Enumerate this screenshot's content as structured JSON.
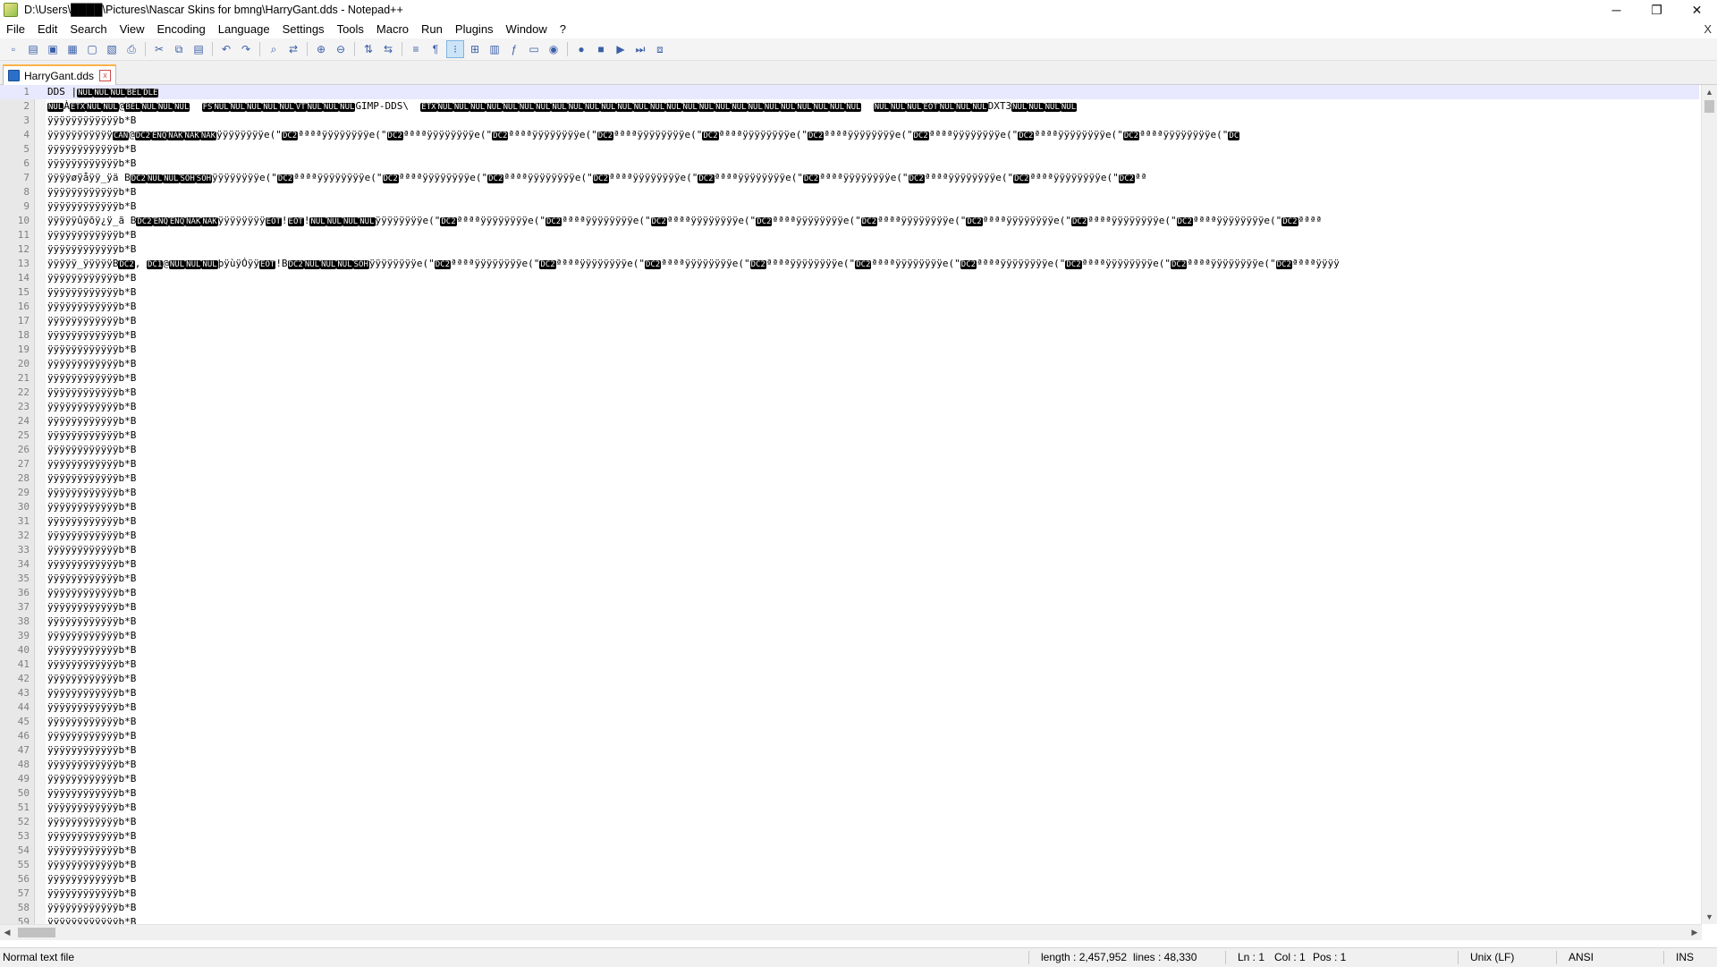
{
  "window": {
    "title": "D:\\Users\\████\\Pictures\\Nascar Skins for bmng\\HarryGant.dds - Notepad++",
    "minimize": "─",
    "restore": "❐",
    "close": "✕"
  },
  "menu": {
    "items": [
      "File",
      "Edit",
      "Search",
      "View",
      "Encoding",
      "Language",
      "Settings",
      "Tools",
      "Macro",
      "Run",
      "Plugins",
      "Window",
      "?"
    ],
    "close_doc": "X"
  },
  "toolbar": {
    "icons": [
      "new-file-icon",
      "open-file-icon",
      "save-icon",
      "save-all-icon",
      "close-icon",
      "close-all-icon",
      "print-icon",
      "|",
      "cut-icon",
      "copy-icon",
      "paste-icon",
      "|",
      "undo-icon",
      "redo-icon",
      "|",
      "find-icon",
      "replace-icon",
      "|",
      "zoom-in-icon",
      "zoom-out-icon",
      "|",
      "sync-vertical-icon",
      "sync-horizontal-icon",
      "|",
      "word-wrap-icon",
      "show-all-chars-icon",
      "indent-guide-icon",
      "user-language-icon",
      "document-map-icon",
      "function-list-icon",
      "folder-as-workspace-icon",
      "monitoring-icon",
      "|",
      "record-macro-icon",
      "stop-macro-icon",
      "play-macro-icon",
      "run-macro-multiple-icon",
      "save-macro-icon"
    ],
    "glyphs": [
      "▫",
      "▤",
      "▣",
      "▦",
      "▢",
      "▧",
      "⎙",
      "|",
      "✂",
      "⧉",
      "▤",
      "|",
      "↶",
      "↷",
      "|",
      "⌕",
      "⇄",
      "|",
      "⊕",
      "⊖",
      "|",
      "⇅",
      "⇆",
      "|",
      "≡",
      "¶",
      "⁝",
      "⊞",
      "▥",
      "ƒ",
      "▭",
      "◉",
      "|",
      "●",
      "■",
      "▶",
      "⏭",
      "⧈"
    ]
  },
  "tab": {
    "label": "HarryGant.dds",
    "close": "x"
  },
  "editor": {
    "lines": [
      {
        "n": "1",
        "parts": [
          {
            "t": "DDS |"
          },
          {
            "c": "NUL"
          },
          {
            "c": "NUL"
          },
          {
            "c": "NUL"
          },
          {
            "c": "BEL"
          },
          {
            "c": "DLE"
          }
        ]
      },
      {
        "n": "2",
        "parts": [
          {
            "c": "NUL"
          },
          {
            "t": "À"
          },
          {
            "c": "ETX"
          },
          {
            "c": "NUL"
          },
          {
            "c": "NUL"
          },
          {
            "t": "@"
          },
          {
            "c": "BEL"
          },
          {
            "c": "NUL"
          },
          {
            "c": "NUL"
          },
          {
            "c": "NUL"
          },
          {
            "t": "  "
          },
          {
            "c": "FS"
          },
          {
            "c": "NUL"
          },
          {
            "c": "NUL"
          },
          {
            "c": "NUL"
          },
          {
            "c": "NUL"
          },
          {
            "c": "NUL"
          },
          {
            "c": "VT"
          },
          {
            "c": "NUL"
          },
          {
            "c": "NUL"
          },
          {
            "c": "NUL"
          },
          {
            "t": "GIMP-DDS\\  "
          },
          {
            "c": "ETX"
          },
          {
            "c": "NUL"
          },
          {
            "c": "NUL"
          },
          {
            "c": "NUL"
          },
          {
            "c": "NUL"
          },
          {
            "c": "NUL"
          },
          {
            "c": "NUL"
          },
          {
            "c": "NUL"
          },
          {
            "c": "NUL"
          },
          {
            "c": "NUL"
          },
          {
            "c": "NUL"
          },
          {
            "c": "NUL"
          },
          {
            "c": "NUL"
          },
          {
            "c": "NUL"
          },
          {
            "c": "NUL"
          },
          {
            "c": "NUL"
          },
          {
            "c": "NUL"
          },
          {
            "c": "NUL"
          },
          {
            "c": "NUL"
          },
          {
            "c": "NUL"
          },
          {
            "c": "NUL"
          },
          {
            "c": "NUL"
          },
          {
            "c": "NUL"
          },
          {
            "c": "NUL"
          },
          {
            "c": "NUL"
          },
          {
            "c": "NUL"
          },
          {
            "c": "NUL"
          },
          {
            "t": "  "
          },
          {
            "c": "NUL"
          },
          {
            "c": "NUL"
          },
          {
            "c": "NUL"
          },
          {
            "c": "EOT"
          },
          {
            "c": "NUL"
          },
          {
            "c": "NUL"
          },
          {
            "c": "NUL"
          },
          {
            "t": "DXT3"
          },
          {
            "c": "NUL"
          },
          {
            "c": "NUL"
          },
          {
            "c": "NUL"
          },
          {
            "c": "NUL"
          }
        ]
      },
      {
        "n": "3",
        "parts": [
          {
            "t": "ÿÿÿÿÿÿÿÿÿÿÿÿb*B"
          }
        ]
      },
      {
        "n": "4",
        "parts": [
          {
            "t": "ÿÿÿÿÿÿÿÿÿÿÿ"
          },
          {
            "c": "CAN"
          },
          {
            "t": "@"
          },
          {
            "c": "DC2"
          },
          {
            "c": "ENQ"
          },
          {
            "c": "NAK"
          },
          {
            "c": "NAK"
          },
          {
            "c": "NAK"
          },
          {
            "t": "ÿÿÿÿÿÿÿÿe(\""
          },
          {
            "c": "DC2"
          },
          {
            "t": "ªªªªÿÿÿÿÿÿÿÿe(\""
          },
          {
            "c": "DC2"
          },
          {
            "t": "ªªªªÿÿÿÿÿÿÿÿe(\""
          },
          {
            "c": "DC2"
          },
          {
            "t": "ªªªªÿÿÿÿÿÿÿÿe(\""
          },
          {
            "c": "DC2"
          },
          {
            "t": "ªªªªÿÿÿÿÿÿÿÿe(\""
          },
          {
            "c": "DC2"
          },
          {
            "t": "ªªªªÿÿÿÿÿÿÿÿe(\""
          },
          {
            "c": "DC2"
          },
          {
            "t": "ªªªªÿÿÿÿÿÿÿÿe(\""
          },
          {
            "c": "DC2"
          },
          {
            "t": "ªªªªÿÿÿÿÿÿÿÿe(\""
          },
          {
            "c": "DC2"
          },
          {
            "t": "ªªªªÿÿÿÿÿÿÿÿe(\""
          },
          {
            "c": "DC2"
          },
          {
            "t": "ªªªªÿÿÿÿÿÿÿÿe(\""
          },
          {
            "c": "DC"
          }
        ]
      },
      {
        "n": "5",
        "parts": [
          {
            "t": "ÿÿÿÿÿÿÿÿÿÿÿÿb*B"
          }
        ]
      },
      {
        "n": "6",
        "parts": [
          {
            "t": "ÿÿÿÿÿÿÿÿÿÿÿÿb*B"
          }
        ]
      },
      {
        "n": "7",
        "parts": [
          {
            "t": "ÿÿÿÿøÿåÿÿ_ÿä B"
          },
          {
            "c": "DC2"
          },
          {
            "c": "NUL"
          },
          {
            "c": "NUL"
          },
          {
            "c": "SOH"
          },
          {
            "c": "SOH"
          },
          {
            "t": "ÿÿÿÿÿÿÿÿe(\""
          },
          {
            "c": "DC2"
          },
          {
            "t": "ªªªªÿÿÿÿÿÿÿÿe(\""
          },
          {
            "c": "DC2"
          },
          {
            "t": "ªªªªÿÿÿÿÿÿÿÿe(\""
          },
          {
            "c": "DC2"
          },
          {
            "t": "ªªªªÿÿÿÿÿÿÿÿe(\""
          },
          {
            "c": "DC2"
          },
          {
            "t": "ªªªªÿÿÿÿÿÿÿÿe(\""
          },
          {
            "c": "DC2"
          },
          {
            "t": "ªªªªÿÿÿÿÿÿÿÿe(\""
          },
          {
            "c": "DC2"
          },
          {
            "t": "ªªªªÿÿÿÿÿÿÿÿe(\""
          },
          {
            "c": "DC2"
          },
          {
            "t": "ªªªªÿÿÿÿÿÿÿÿe(\""
          },
          {
            "c": "DC2"
          },
          {
            "t": "ªªªªÿÿÿÿÿÿÿÿe(\""
          },
          {
            "c": "DC2"
          },
          {
            "t": "ªª"
          }
        ]
      },
      {
        "n": "8",
        "parts": [
          {
            "t": "ÿÿÿÿÿÿÿÿÿÿÿÿb*B"
          }
        ]
      },
      {
        "n": "9",
        "parts": [
          {
            "t": "ÿÿÿÿÿÿÿÿÿÿÿÿb*B"
          }
        ]
      },
      {
        "n": "10",
        "parts": [
          {
            "t": "ÿÿÿÿÿûÿõÿ¿ÿ_ã B"
          },
          {
            "c": "DC2"
          },
          {
            "c": "ENQ"
          },
          {
            "c": "ENQ"
          },
          {
            "c": "NAK"
          },
          {
            "c": "NAK"
          },
          {
            "t": "ÿÿÿÿÿÿÿÿ"
          },
          {
            "c": "EOT"
          },
          {
            "t": "!"
          },
          {
            "c": "EOT"
          },
          {
            "t": "!"
          },
          {
            "c": "NUL"
          },
          {
            "c": "NUL"
          },
          {
            "c": "NUL"
          },
          {
            "c": "NUL"
          },
          {
            "t": "ÿÿÿÿÿÿÿÿe(\""
          },
          {
            "c": "DC2"
          },
          {
            "t": "ªªªªÿÿÿÿÿÿÿÿe(\""
          },
          {
            "c": "DC2"
          },
          {
            "t": "ªªªªÿÿÿÿÿÿÿÿe(\""
          },
          {
            "c": "DC2"
          },
          {
            "t": "ªªªªÿÿÿÿÿÿÿÿe(\""
          },
          {
            "c": "DC2"
          },
          {
            "t": "ªªªªÿÿÿÿÿÿÿÿe(\""
          },
          {
            "c": "DC2"
          },
          {
            "t": "ªªªªÿÿÿÿÿÿÿÿe(\""
          },
          {
            "c": "DC2"
          },
          {
            "t": "ªªªªÿÿÿÿÿÿÿÿe(\""
          },
          {
            "c": "DC2"
          },
          {
            "t": "ªªªªÿÿÿÿÿÿÿÿe(\""
          },
          {
            "c": "DC2"
          },
          {
            "t": "ªªªªÿÿÿÿÿÿÿÿe(\""
          },
          {
            "c": "DC2"
          },
          {
            "t": "ªªªª"
          }
        ]
      },
      {
        "n": "11",
        "parts": [
          {
            "t": "ÿÿÿÿÿÿÿÿÿÿÿÿb*B"
          }
        ]
      },
      {
        "n": "12",
        "parts": [
          {
            "t": "ÿÿÿÿÿÿÿÿÿÿÿÿb*B"
          }
        ]
      },
      {
        "n": "13",
        "parts": [
          {
            "t": "ÿÿÿÿÿ_ÿÿÿÿÿB"
          },
          {
            "c": "DC2"
          },
          {
            "t": ", "
          },
          {
            "c": "DC1"
          },
          {
            "t": "@"
          },
          {
            "c": "NUL"
          },
          {
            "c": "NUL"
          },
          {
            "c": "NUL"
          },
          {
            "t": "þÿùÿÓÿÿ"
          },
          {
            "c": "EOT"
          },
          {
            "t": "!B"
          },
          {
            "c": "DC2"
          },
          {
            "c": "NUL"
          },
          {
            "c": "NUL"
          },
          {
            "c": "NUL"
          },
          {
            "c": "SOH"
          },
          {
            "t": "ÿÿÿÿÿÿÿÿe(\""
          },
          {
            "c": "DC2"
          },
          {
            "t": "ªªªªÿÿÿÿÿÿÿÿe(\""
          },
          {
            "c": "DC2"
          },
          {
            "t": "ªªªªÿÿÿÿÿÿÿÿe(\""
          },
          {
            "c": "DC2"
          },
          {
            "t": "ªªªªÿÿÿÿÿÿÿÿe(\""
          },
          {
            "c": "DC2"
          },
          {
            "t": "ªªªªÿÿÿÿÿÿÿÿe(\""
          },
          {
            "c": "DC2"
          },
          {
            "t": "ªªªªÿÿÿÿÿÿÿÿe(\""
          },
          {
            "c": "DC2"
          },
          {
            "t": "ªªªªÿÿÿÿÿÿÿÿe(\""
          },
          {
            "c": "DC2"
          },
          {
            "t": "ªªªªÿÿÿÿÿÿÿÿe(\""
          },
          {
            "c": "DC2"
          },
          {
            "t": "ªªªªÿÿÿÿÿÿÿÿe(\""
          },
          {
            "c": "DC2"
          },
          {
            "t": "ªªªªÿÿÿÿ"
          }
        ]
      }
    ],
    "repeat_text": "ÿÿÿÿÿÿÿÿÿÿÿÿb*B",
    "repeat_from": 14,
    "repeat_to": 59
  },
  "scroll": {
    "up": "▲",
    "down": "▼",
    "left": "◀",
    "right": "▶"
  },
  "status": {
    "file_type": "Normal text file",
    "length": "length : 2,457,952",
    "lines": "lines : 48,330",
    "ln": "Ln : 1",
    "col": "Col : 1",
    "pos": "Pos : 1",
    "eol": "Unix (LF)",
    "encoding": "ANSI",
    "mode": "INS"
  }
}
